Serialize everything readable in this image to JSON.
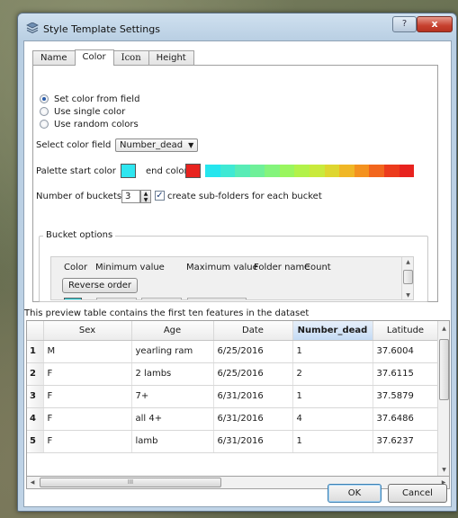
{
  "window": {
    "title": "Style Template Settings",
    "help_label": "?",
    "close_label": "x"
  },
  "tabs": [
    {
      "label": "Name"
    },
    {
      "label": "Color"
    },
    {
      "label": "Icon"
    },
    {
      "label": "Height"
    }
  ],
  "color_mode": {
    "options": [
      {
        "label": "Set color from field",
        "checked": true
      },
      {
        "label": "Use single color",
        "checked": false
      },
      {
        "label": "Use random colors",
        "checked": false
      }
    ]
  },
  "select_field": {
    "label": "Select color field",
    "value": "Number_dead"
  },
  "palette": {
    "start_label": "Palette start color",
    "end_label": "end color",
    "start_color": "#2ee6f0",
    "end_color": "#e8231f",
    "gradient_colors": [
      "#25e6ee",
      "#3fe9d4",
      "#58ecb6",
      "#6ff099",
      "#84f47c",
      "#9af65f",
      "#b2f24a",
      "#c9ea3c",
      "#ded630",
      "#f0b726",
      "#f4921f",
      "#f2661d",
      "#ec3b1c",
      "#e8231f"
    ]
  },
  "buckets": {
    "label": "Number of buckets",
    "value": "3",
    "subfolders_label": "create sub-folders for each bucket",
    "subfolders_checked": "✓"
  },
  "bucket_options": {
    "title": "Bucket options",
    "columns": [
      "Color",
      "Minimum value",
      "Maximum value",
      "Folder name",
      "Count"
    ],
    "reverse_label": "Reverse order",
    "first_row_color": "#2ee6f0"
  },
  "preview": {
    "note": "This preview table contains the first ten features in the dataset",
    "columns": [
      "",
      "Sex",
      "Age",
      "Date",
      "Number_dead",
      "Latitude"
    ],
    "selected_column": "Number_dead",
    "rows": [
      [
        "1",
        "M",
        "yearling ram",
        "6/25/2016",
        "1",
        "37.6004"
      ],
      [
        "2",
        "F",
        "2 lambs",
        "6/25/2016",
        "2",
        "37.6115"
      ],
      [
        "3",
        "F",
        "7+",
        "6/31/2016",
        "1",
        "37.5879"
      ],
      [
        "4",
        "F",
        "all 4+",
        "6/31/2016",
        "4",
        "37.6486"
      ],
      [
        "5",
        "F",
        "lamb",
        "6/31/2016",
        "1",
        "37.6237"
      ]
    ],
    "scroll_grip": "III"
  },
  "buttons": {
    "ok": "OK",
    "cancel": "Cancel"
  }
}
